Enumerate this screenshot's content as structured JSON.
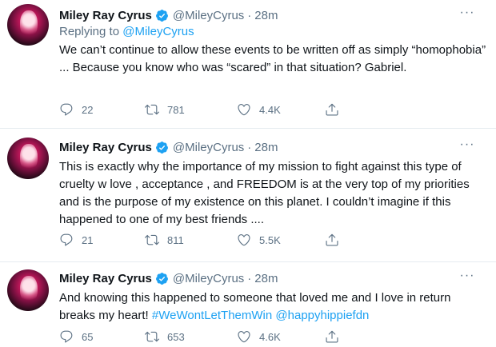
{
  "colors": {
    "link": "#1da1f2",
    "secondary": "#5b7083",
    "verified": "#1da1f2"
  },
  "tweets": [
    {
      "name": "Miley Ray Cyrus",
      "handle": "@MileyCyrus",
      "dot": "·",
      "time": "28m",
      "replying_prefix": "Replying to ",
      "replying_to": "@MileyCyrus",
      "text": "We can’t continue to allow these events to be written off as simply “homophobia” ... Because you know who was “scared” in that situation? Gabriel.",
      "replies": "22",
      "retweets": "781",
      "likes": "4.4K",
      "more": "···"
    },
    {
      "name": "Miley Ray Cyrus",
      "handle": "@MileyCyrus",
      "dot": "·",
      "time": "28m",
      "text": "This is exactly why the importance of my mission to fight against this type of cruelty w love , acceptance , and FREEDOM is at the very top of my priorities and is the purpose of my existence on this planet. I couldn’t imagine if this happened to one of my best friends ....",
      "replies": "21",
      "retweets": "811",
      "likes": "5.5K",
      "more": "···"
    },
    {
      "name": "Miley Ray Cyrus",
      "handle": "@MileyCyrus",
      "dot": "·",
      "time": "28m",
      "text_plain": "And knowing this happened to someone that loved me and I love in return breaks my heart! ",
      "hashtag": "#WeWontLetThemWin",
      "space": " ",
      "mention": "@happyhippiefdn",
      "replies": "65",
      "retweets": "653",
      "likes": "4.6K",
      "more": "···"
    }
  ],
  "icons": {
    "reply": "reply-icon",
    "retweet": "retweet-icon",
    "like": "heart-icon",
    "share": "share-icon",
    "verified": "verified-badge-icon",
    "more": "more-icon"
  }
}
